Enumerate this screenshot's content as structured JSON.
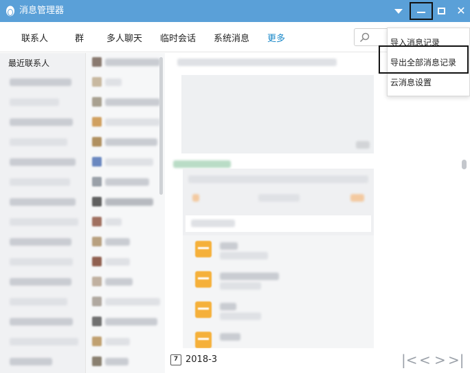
{
  "window": {
    "title": "消息管理器"
  },
  "tabs": [
    {
      "label": "联系人"
    },
    {
      "label": "群"
    },
    {
      "label": "多人聊天"
    },
    {
      "label": "临时会话"
    },
    {
      "label": "系统消息"
    },
    {
      "label": "更多"
    }
  ],
  "sidebar": {
    "recent_label": "最近联系人"
  },
  "dropdown_menu": {
    "items": [
      {
        "label": "导入消息记录"
      },
      {
        "label": "导出全部消息记录"
      },
      {
        "label": "云消息设置"
      }
    ]
  },
  "bottom_bar": {
    "date": "2018-3"
  },
  "colors": {
    "titlebar": "#5aa0d8",
    "active_tab": "#1a88c9",
    "folder": "#f5b03a"
  }
}
